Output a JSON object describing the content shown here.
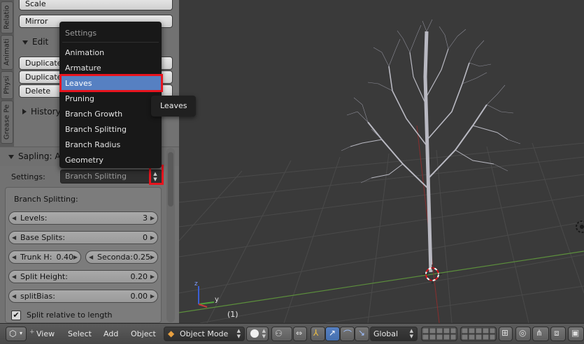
{
  "shelf": {
    "tabs": [
      "Relatio",
      "Animati",
      "Physi",
      "Grease Pe"
    ],
    "top_buttons": [
      "Scale",
      "Mirror"
    ],
    "edit_panel": {
      "title": "Edit",
      "buttons": [
        "Duplicate",
        "Duplicate",
        "Delete"
      ]
    },
    "history_title": "History",
    "sapling_title": "Sapling: Ad",
    "settings_label": "Settings:",
    "settings_value": "Branch Splitting",
    "branch_section_title": "Branch Splitting:",
    "fields": {
      "levels": {
        "label": "Levels:",
        "value": "3"
      },
      "base_splits": {
        "label": "Base Splits:",
        "value": "0"
      },
      "trunk_h": {
        "label": "Trunk H:",
        "value": "0.40"
      },
      "seconda": {
        "label": "Seconda:",
        "value": "0.25"
      },
      "split_height": {
        "label": "Split Height:",
        "value": "0.20"
      },
      "split_bias": {
        "label": "splitBias:",
        "value": "0.00"
      }
    },
    "checkbox": {
      "label": "Split relative to length",
      "checked": true
    }
  },
  "dropdown": {
    "title": "Settings",
    "items": [
      "Animation",
      "Armature",
      "Leaves",
      "Pruning",
      "Branch Growth",
      "Branch Splitting",
      "Branch Radius",
      "Geometry"
    ],
    "active_item": "Leaves"
  },
  "tooltip": {
    "text": "Leaves"
  },
  "viewport": {
    "frame_label": "(1)",
    "axis_y_label": "y",
    "axis_z_label": "z"
  },
  "header": {
    "menus": [
      "View",
      "Select",
      "Add",
      "Object"
    ],
    "mode": "Object Mode",
    "orientation": "Global"
  },
  "colors": {
    "highlight_red": "#e8141e",
    "menu_active_blue": "#5680c2",
    "grid_green": "#6aa84f"
  }
}
